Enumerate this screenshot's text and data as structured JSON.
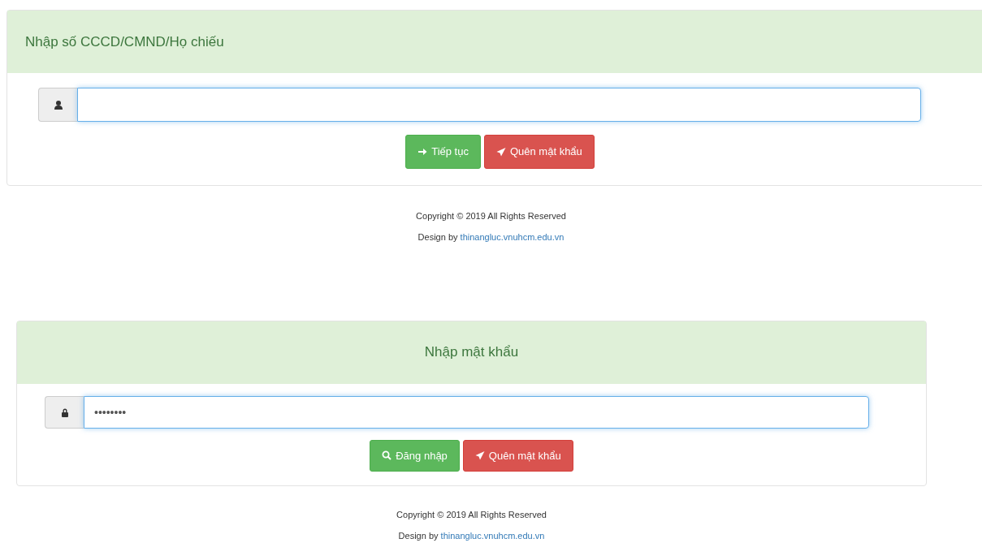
{
  "panels": [
    {
      "title": "Nhập số CCCD/CMND/Họ chiếu",
      "field": {
        "kind": "id",
        "focused": true
      },
      "buttons": [
        {
          "label": "Tiếp tục",
          "kind": "next"
        },
        {
          "label": "Quên mật khẩu",
          "kind": "forgot"
        }
      ],
      "footer": {
        "copyright_before": "Copyright ©",
        "year": "2019",
        "copyright_after": "All Rights Reserved",
        "design_by": "Design by",
        "site": "thinangluc.vnuhcm.edu.vn"
      }
    },
    {
      "title": "Nhập mật khẩu",
      "field": {
        "kind": "password",
        "value": "••••••••",
        "focused": true
      },
      "buttons": [
        {
          "label": "Đăng nhập",
          "kind": "login"
        },
        {
          "label": "Quên mật khẩu",
          "kind": "forgot"
        }
      ],
      "footer": {
        "copyright_before": "Copyright ©",
        "year": "2019",
        "copyright_after": "All Rights Reserved",
        "design_by": "Design by",
        "site": "thinangluc.vnuhcm.edu.vn"
      }
    }
  ]
}
